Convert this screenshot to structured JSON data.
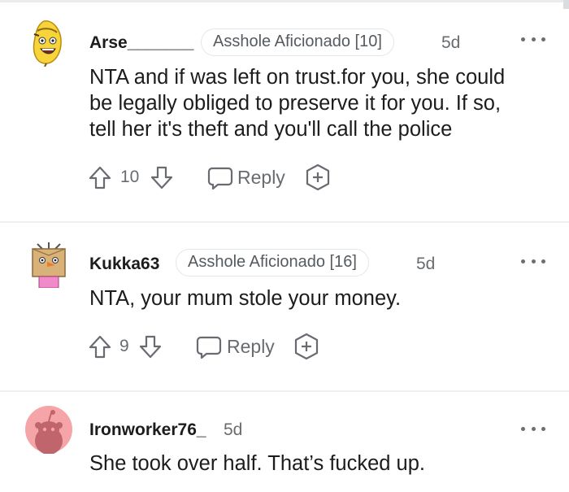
{
  "comments": [
    {
      "username": "Arse_______",
      "flair": "Asshole Aficionado [10]",
      "age": "5d",
      "lines": [
        "NTA and if was left on trust.for you, she could",
        "be legally obliged to preserve it for you. If so,",
        "tell her it's theft and you'll call the police"
      ],
      "votes": "10",
      "reply_label": "Reply"
    },
    {
      "username": "Kukka63",
      "flair": "Asshole Aficionado [16]",
      "age": "5d",
      "lines": [
        "NTA, your mum stole your money."
      ],
      "votes": "9",
      "reply_label": "Reply"
    },
    {
      "username": "Ironworker76_",
      "age": "5d",
      "lines": [
        "She took over half. That’s fucked up."
      ]
    }
  ],
  "colors": {
    "text": "#1c1c1c",
    "muted": "#686c70",
    "divider": "#edeff1",
    "avatar3_bg": "#f5a4a8"
  },
  "icons": [
    "upvote-icon",
    "downvote-icon",
    "reply-bubble-icon",
    "award-plus-icon",
    "more-options-icon"
  ]
}
